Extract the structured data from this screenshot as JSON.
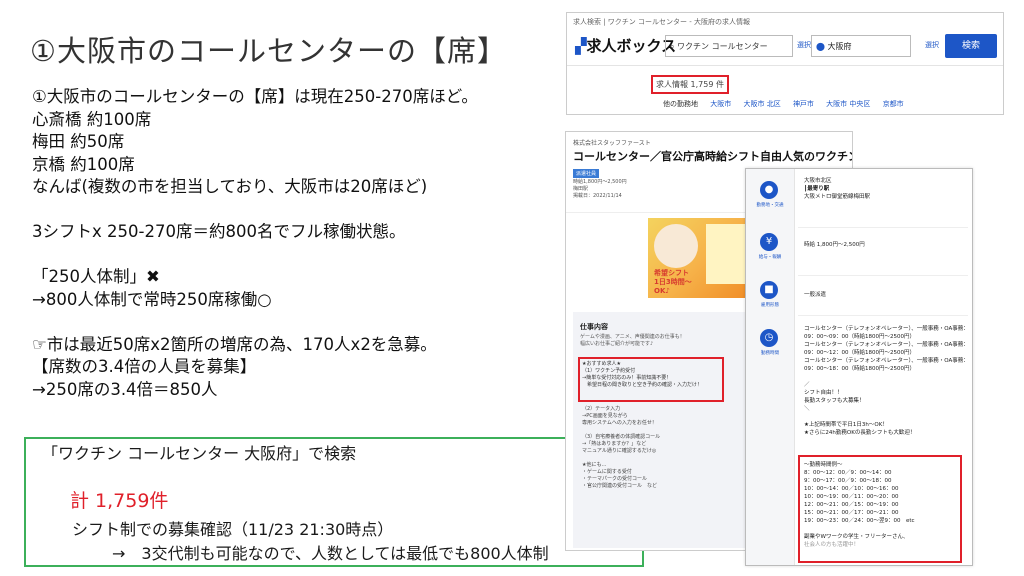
{
  "slide": {
    "title": "①大阪市のコールセンターの【席】",
    "notes": [
      "①大阪市のコールセンターの【席】は現在250-270席ほど。",
      "心斎橋 約100席",
      "梅田 約50席",
      "京橋 約100席",
      "なんば(複数の市を担当しており、大阪市は20席ほど)",
      "",
      "3シフトx 250-270席＝約800名でフル稼働状態。",
      "",
      "「250人体制」",
      "→800人体制で常時250席稼働○",
      "",
      "市は最近50席x2箇所の増席の為、170人x2を急募。",
      "【席数の3.4倍の人員を募集】",
      "→250席の3.4倍＝850人"
    ],
    "x_mark": "✖",
    "pointer_glyph": "☞",
    "search_box": {
      "query_line": "「ワクチン コールセンター 大阪府」で検索",
      "total": "計 1,759件",
      "confirm": "シフト制での募集確認（11/23 21:30時点）",
      "note": "→　3交代制も可能なので、人数としては最低でも800人体制"
    }
  },
  "screenshot_search": {
    "breadcrumb": "求人検索 | ワクチン コールセンター - 大阪府の求人情報",
    "logo": "求人ボックス",
    "keyword": "ワクチン コールセンター",
    "select_label": "選択",
    "location": "大阪府",
    "search_button": "検索",
    "count": "求人情報 1,759 件",
    "related_links": [
      "他の勤務地",
      "大阪市",
      "大阪市 北区",
      "神戸市",
      "大阪市 中央区",
      "京都市"
    ]
  },
  "screenshot_job": {
    "company": "株式会社スタッフファースト",
    "title": "コールセンター／官公庁高時給シフト自由人気のワクチン受付や",
    "tag": "派遣社員",
    "meta": [
      "時給1,800円〜2,500円",
      "梅田駅",
      "掲載日：2022/11/14"
    ],
    "image_caption": [
      "希望シフト",
      "1日3時間〜",
      "OK♪"
    ],
    "section_title": "仕事内容",
    "desc": [
      "ゲームや漫画、アニメ、声優関連のお仕事も！",
      "幅広いお仕事ご紹介が可能です♪"
    ],
    "box_lines": [
      "★おすすめ求人★",
      "（1）ワクチン予約受付",
      "→簡単な受付対応のみ！事前知識不要！",
      "　希望日程の聞き取りと空き予約の確認・入力だけ！"
    ],
    "more_lines": [
      "（2）テータ入力",
      "→PC画面を見ながら",
      "専用システムへの入力をお任せ！",
      "",
      "（3）自宅療養者の体調確認コール",
      "→「熱はありますか？」など",
      "マニュアル通りに確認するだけ◎",
      "",
      "★他にも…",
      "・ゲームに関する受付",
      "・テーマパークの受付コール",
      "・官公庁関連の受付コール　など"
    ]
  },
  "screenshot_info": {
    "side": [
      {
        "icon": "location-icon",
        "glyph": "●",
        "label": "勤務地・交通"
      },
      {
        "icon": "yen-icon",
        "glyph": "¥",
        "label": "給与・報酬"
      },
      {
        "icon": "briefcase-icon",
        "glyph": "■",
        "label": "雇用形態"
      },
      {
        "icon": "clock-icon",
        "glyph": "◷",
        "label": "勤務時間"
      }
    ],
    "location_lines": [
      "大阪市北区",
      "┃最寄り駅",
      "大阪メトロ御堂筋線梅田駅"
    ],
    "pay": "時給 1,800円〜2,500円",
    "employment": "一般派遣",
    "hours_lines": [
      "コールセンター（テレフォンオペレーター）、一般事務・OA事務：",
      "09：00〜09：00（時給1800円〜2500円）",
      "コールセンター（テレフォンオペレーター）、一般事務・OA事務：",
      "09：00〜12：00（時給1800円〜2500円）",
      "コールセンター（テレフォンオペレーター）、一般事務・OA事務：",
      "09：00〜18：00（時給1800円〜2500円）",
      "",
      "／",
      "シフト自由！！",
      "長勤スタッフも大募集！",
      "＼",
      "",
      "★上記時間帯で平日1日3h〜OK！",
      "★さらに24h勤務OKの長勤シフトも大歓迎！"
    ],
    "shift_lines": [
      "〜勤務時間例〜",
      "8：00〜12：00／9：00〜14：00",
      "9：00〜17：00／9：00〜18：00",
      "10：00〜14：00／10：00〜16：00",
      "10：00〜19：00／11：00〜20：00",
      "12：00〜21：00／15：00〜19：00",
      "15：00〜21：00／17：00〜21：00",
      "19：00〜23：00／24：00〜翌9：00　etc",
      "",
      "副業やWワークの学生・フリーターさん、",
      "社会人の方も活躍中！"
    ]
  }
}
